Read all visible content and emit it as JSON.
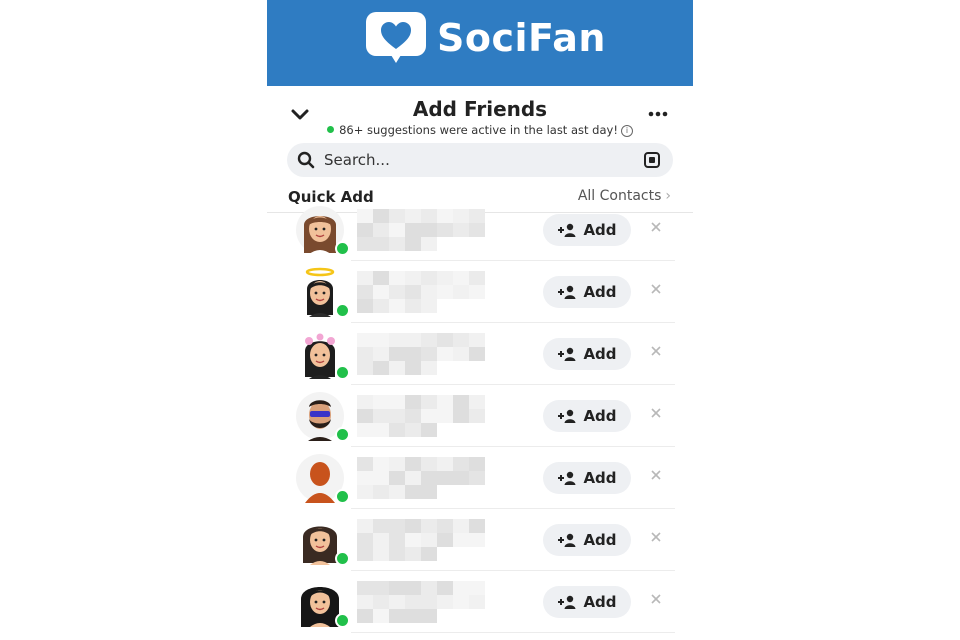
{
  "brand": {
    "name": "SociFan",
    "colors": {
      "banner": "#2f7cc2",
      "online": "#21c04a"
    }
  },
  "header": {
    "title": "Add Friends",
    "subtitle": "86+ suggestions were active in the last ast day!",
    "collapse_icon": "chevron-down-icon",
    "more_icon": "more-dots-icon"
  },
  "search": {
    "placeholder": "Search...",
    "scan_icon": "scan-icon"
  },
  "quick_add": {
    "label": "Quick Add",
    "all_contacts_label": "All Contacts",
    "chevron": "›"
  },
  "suggestions": [
    {
      "avatar": "avatar-woman-bangs",
      "online": true,
      "add_label": "Add"
    },
    {
      "avatar": "avatar-woman-halo",
      "online": true,
      "add_label": "Add"
    },
    {
      "avatar": "avatar-woman-flowers",
      "online": true,
      "add_label": "Add"
    },
    {
      "avatar": "avatar-man-sunglasses-beard",
      "online": true,
      "add_label": "Add"
    },
    {
      "avatar": "avatar-silhouette",
      "online": true,
      "add_label": "Add"
    },
    {
      "avatar": "avatar-woman-long-hair",
      "online": true,
      "add_label": "Add"
    },
    {
      "avatar": "avatar-woman-dark-hair",
      "online": true,
      "add_label": "Add"
    }
  ]
}
